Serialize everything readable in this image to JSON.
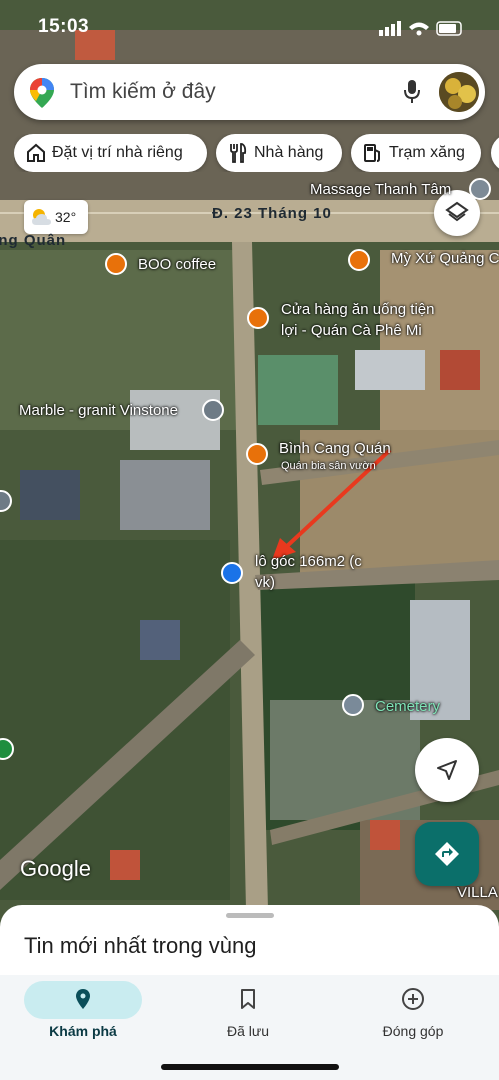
{
  "status": {
    "time": "15:03"
  },
  "search": {
    "placeholder": "Tìm kiếm ở đây"
  },
  "chips": [
    {
      "label": "Đặt vị trí nhà riêng",
      "icon": "home-icon"
    },
    {
      "label": "Nhà hàng",
      "icon": "restaurant-icon"
    },
    {
      "label": "Trạm xăng",
      "icon": "gas-station-icon"
    }
  ],
  "weather": {
    "temp": "32°"
  },
  "map": {
    "streets": {
      "main": "Đ. 23 Tháng 10",
      "left": "Long Quân"
    },
    "places": {
      "massage": "Massage Thanh Tâm",
      "boo": "BOO coffee",
      "myxu": "Mỳ Xứ Quảng C",
      "store_line1": "Cửa hàng ăn uống tiện",
      "store_line2": "lợi - Quán Cà Phê Mi",
      "marble": "Marble - granit Vinstone",
      "binhcang": "Bình Cang Quán",
      "binhcang_sub": "Quán bia sân vườn",
      "pin_line1": "lô góc 166m2 (c",
      "pin_line2": "vk)",
      "cemetery": "Cemetery",
      "villa": "VILLA"
    },
    "attribution": "Google"
  },
  "sheet": {
    "title": "Tin mới nhất trong vùng"
  },
  "nav": [
    {
      "label": "Khám phá",
      "icon": "explore-pin-icon",
      "active": true
    },
    {
      "label": "Đã lưu",
      "icon": "bookmark-icon",
      "active": false
    },
    {
      "label": "Đóng góp",
      "icon": "add-circle-icon",
      "active": false
    }
  ],
  "colors": {
    "accent": "#0b6f6a",
    "poi": "#e8710a",
    "active_pill": "#c9ecf0"
  }
}
